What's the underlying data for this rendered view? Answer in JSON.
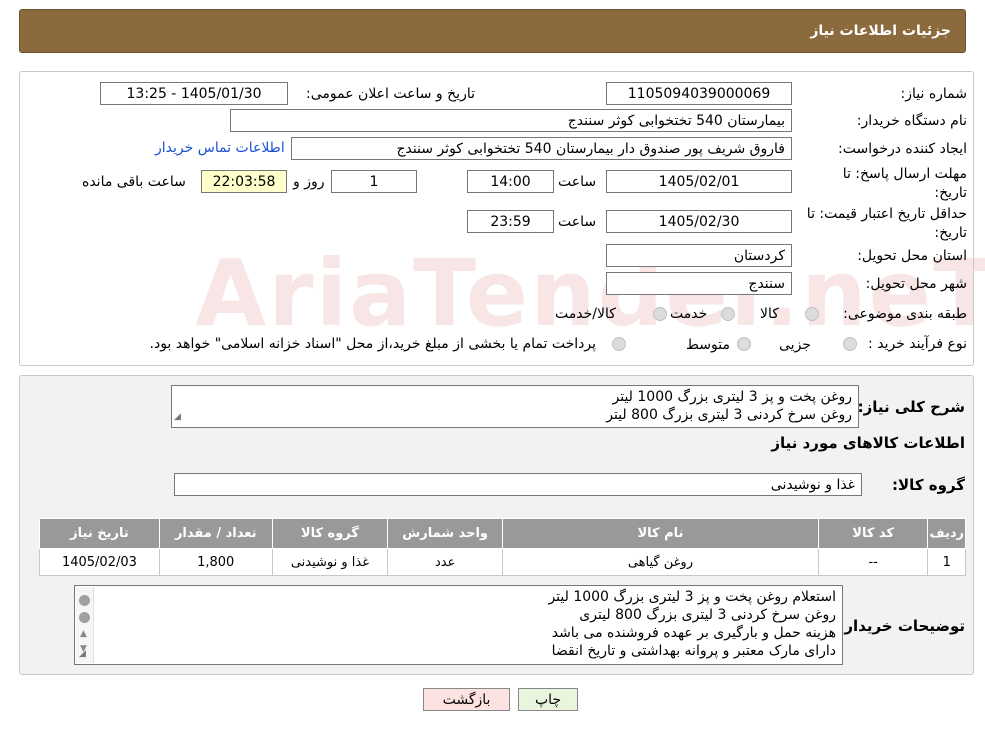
{
  "header": {
    "title": "جزئیات اطلاعات نیاز"
  },
  "watermark": "AriaTender.neT",
  "form": {
    "need_number_label": "شماره نیاز:",
    "need_number": "1105094039000069",
    "announce_label": "تاریخ و ساعت اعلان عمومی:",
    "announce_value": "1405/01/30 - 13:25",
    "buyer_org_label": "نام دستگاه خریدار:",
    "buyer_org": "بیمارستان 540 تختخوابی کوثر سنندج",
    "creator_label": "ایجاد کننده درخواست:",
    "creator": "فاروق شریف پور صندوق دار بیمارستان 540 تختخوابی کوثر سنندج",
    "contact_link": "اطلاعات تماس خریدار",
    "reply_deadline_label": "مهلت ارسال پاسخ: تا تاریخ:",
    "reply_date": "1405/02/01",
    "time_label": "ساعت",
    "reply_time": "14:00",
    "days_value": "1",
    "days_label": "روز و",
    "remaining_time": "22:03:58",
    "remaining_label": "ساعت باقی مانده",
    "price_validity_label": "حداقل تاریخ اعتبار قیمت: تا تاریخ:",
    "price_date": "1405/02/30",
    "price_time": "23:59",
    "province_label": "استان محل تحویل:",
    "province": "کردستان",
    "city_label": "شهر محل تحویل:",
    "city": "سنندج",
    "category_label": "طبقه بندی موضوعی:",
    "category_options": [
      "کالا",
      "خدمت",
      "کالا/خدمت"
    ],
    "process_label": "نوع فرآیند خرید :",
    "process_options": [
      "جزیی",
      "متوسط"
    ],
    "process_note": "پرداخت تمام یا بخشی از مبلغ خرید،از محل \"اسناد خزانه اسلامی\" خواهد بود."
  },
  "details": {
    "summary_label": "شرح کلی نیاز:",
    "summary_lines": [
      "روغن پخت و پز 3 لیتری بزرگ 1000 لیتر",
      "روغن سرخ کردنی 3 لیتری بزرگ 800 لیتر"
    ],
    "goods_info_title": "اطلاعات کالاهای مورد نیاز",
    "goods_group_label": "گروه کالا:",
    "goods_group": "غذا و نوشیدنی",
    "table": {
      "headers": [
        "ردیف",
        "کد کالا",
        "نام کالا",
        "واحد شمارش",
        "گروه کالا",
        "تعداد / مقدار",
        "تاریخ نیاز"
      ],
      "rows": [
        [
          "1",
          "--",
          "روغن گیاهی",
          "عدد",
          "غذا و نوشیدنی",
          "1,800",
          "1405/02/03"
        ]
      ]
    },
    "buyer_notes_label": "توضیحات خریدار:",
    "buyer_notes_lines": [
      "استعلام روغن پخت و پز 3 لیتری بزرگ 1000 لیتر",
      "روغن سرخ کردنی 3 لیتری بزرگ 800 لیتری",
      "هزینه حمل و بارگیری بر عهده فروشنده می باشد",
      "دارای مارک معتبر و پروانه بهداشتی و تاریخ انقضا"
    ]
  },
  "buttons": {
    "print": "چاپ",
    "back": "بازگشت"
  }
}
